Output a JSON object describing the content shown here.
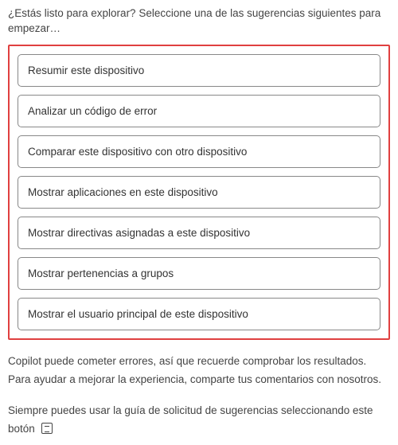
{
  "intro": "¿Estás listo para explorar? Seleccione una de las sugerencias siguientes para empezar…",
  "suggestions": {
    "items": [
      {
        "label": "Resumir este dispositivo"
      },
      {
        "label": "Analizar un código de error"
      },
      {
        "label": "Comparar este dispositivo con otro dispositivo"
      },
      {
        "label": "Mostrar aplicaciones en este dispositivo"
      },
      {
        "label": "Mostrar directivas asignadas a este dispositivo"
      },
      {
        "label": "Mostrar pertenencias a grupos"
      },
      {
        "label": "Mostrar el usuario principal de este dispositivo"
      }
    ]
  },
  "disclaimer": "Copilot puede cometer errores, así que recuerde comprobar los resultados. Para ayudar a mejorar la experiencia, comparte tus comentarios con nosotros.",
  "guide": "Siempre puedes usar la guía de solicitud de sugerencias seleccionando este botón"
}
